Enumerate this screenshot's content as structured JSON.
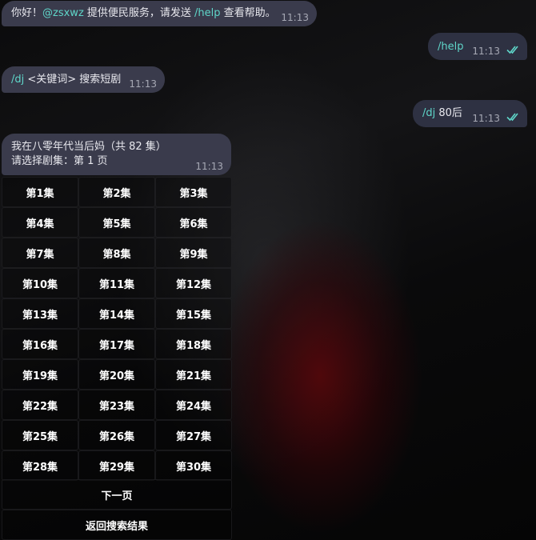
{
  "messages": {
    "m1": {
      "greeting": "你好！",
      "mention": "@zsxwz",
      "text_before": " 提供便民服务，请发送 ",
      "cmd": "/help",
      "text_after": " 查看帮助。",
      "time": "11:13"
    },
    "m2": {
      "cmd": "/help",
      "time": "11:13",
      "status": "read"
    },
    "m3": {
      "cmd": "/dj",
      "text": " <关键词> 搜索短剧",
      "time": "11:13"
    },
    "m4": {
      "cmd": "/dj",
      "text": " 80后",
      "time": "11:13",
      "status": "read"
    },
    "m5": {
      "line1": "我在八零年代当后妈（共 82 集）",
      "line2": "请选择剧集：第 1 页",
      "time": "11:13"
    }
  },
  "episodes": [
    "第1集",
    "第2集",
    "第3集",
    "第4集",
    "第5集",
    "第6集",
    "第7集",
    "第8集",
    "第9集",
    "第10集",
    "第11集",
    "第12集",
    "第13集",
    "第14集",
    "第15集",
    "第16集",
    "第17集",
    "第18集",
    "第19集",
    "第20集",
    "第21集",
    "第22集",
    "第23集",
    "第24集",
    "第25集",
    "第26集",
    "第27集",
    "第28集",
    "第29集",
    "第30集"
  ],
  "nav": {
    "next": "下一页",
    "back": "返回搜索结果"
  },
  "colors": {
    "accent": "#5fd6c9",
    "bubble_in": "#3a3b4c",
    "bubble_out": "#2e3142"
  },
  "icons": {
    "read_status": "double-check-icon"
  }
}
